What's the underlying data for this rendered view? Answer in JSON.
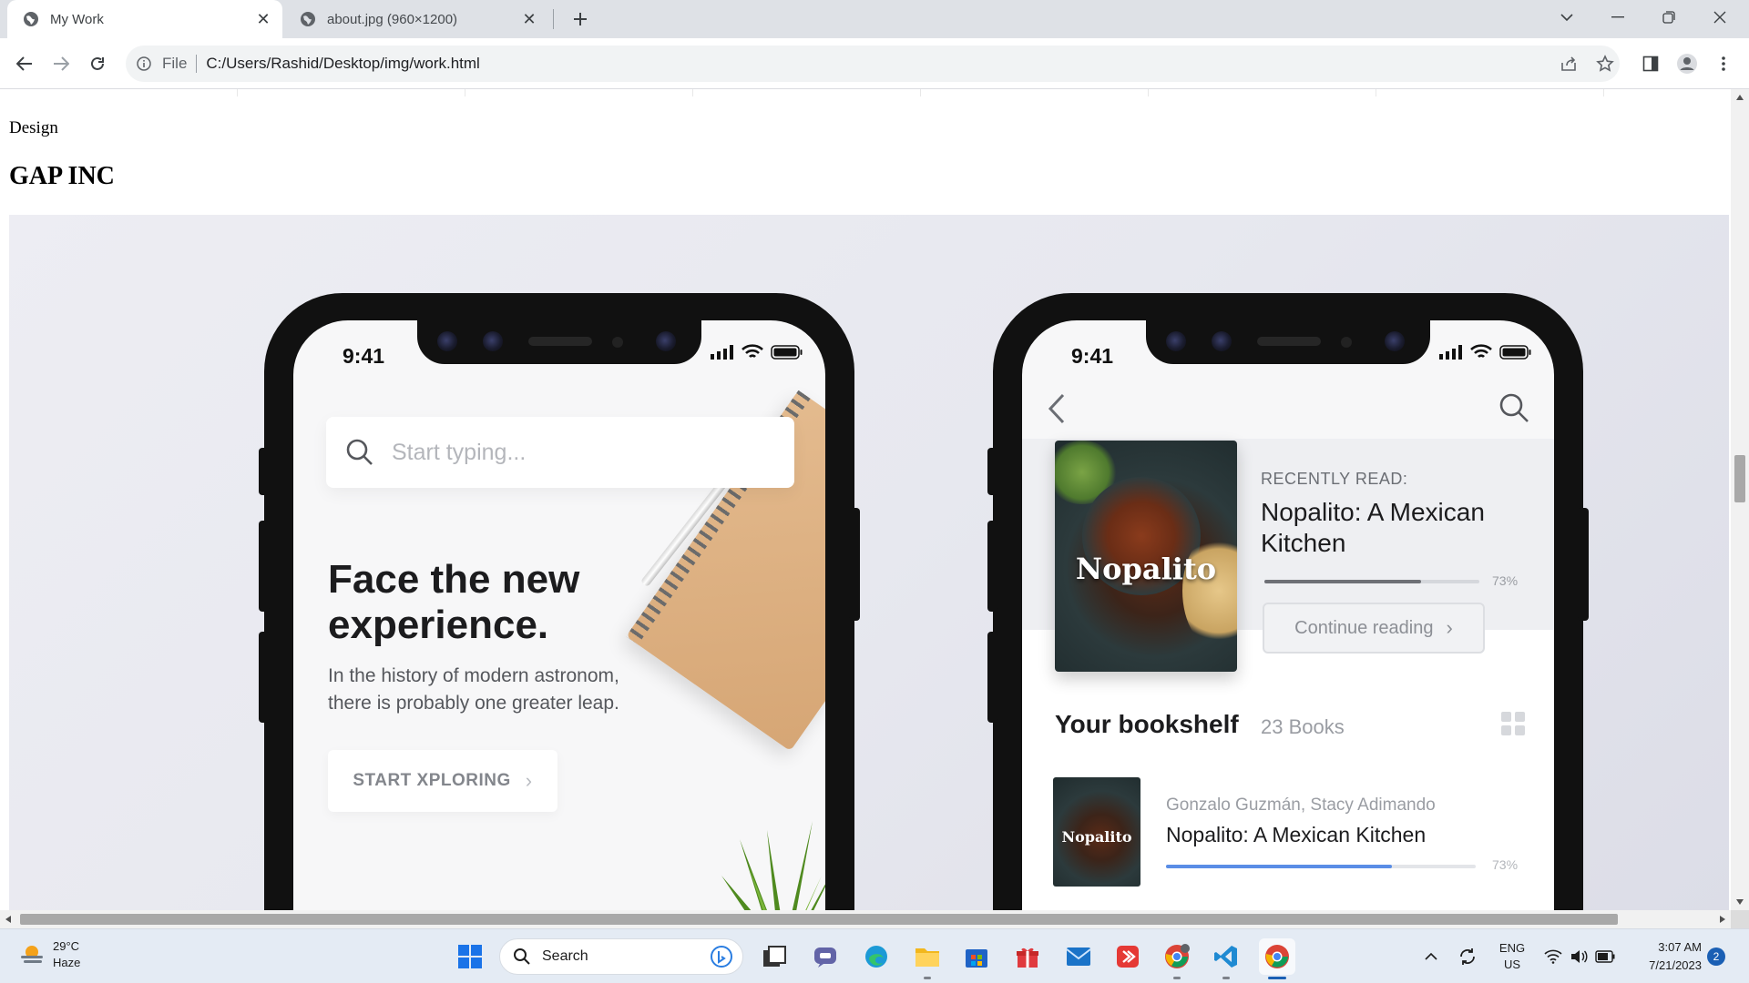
{
  "browser": {
    "tabs": [
      {
        "title": "My Work",
        "active": true
      },
      {
        "title": "about.jpg (960×1200)",
        "active": false
      }
    ],
    "omnibox": {
      "scheme": "File",
      "url": "C:/Users/Rashid/Desktop/img/work.html"
    }
  },
  "page": {
    "category": "Design",
    "project_title": "GAP INC"
  },
  "mockup": {
    "left_phone": {
      "time": "9:41",
      "search_placeholder": "Start typing...",
      "headline": "Face the new experience.",
      "subtext": "In the history of modern astronom, there is probably one greater leap.",
      "cta": "START XPLORING"
    },
    "right_phone": {
      "time": "9:41",
      "recent_label": "RECENTLY READ:",
      "recent_title": "Nopalito: A Mexican Kitchen",
      "cover_title": "Nopalito",
      "progress_percent": 73,
      "progress_label": "73%",
      "continue_label": "Continue reading",
      "shelf_title": "Your bookshelf",
      "shelf_count": "23 Books",
      "item": {
        "author": "Gonzalo Guzmán, Stacy Adimando",
        "title": "Nopalito: A Mexican Kitchen",
        "progress_percent": 73,
        "progress_label": "73%"
      }
    }
  },
  "taskbar": {
    "weather": {
      "temp": "29°C",
      "condition": "Haze"
    },
    "search_label": "Search",
    "language": {
      "line1": "ENG",
      "line2": "US"
    },
    "clock": {
      "time": "3:07 AM",
      "date": "7/21/2023"
    },
    "notifications": "2"
  }
}
